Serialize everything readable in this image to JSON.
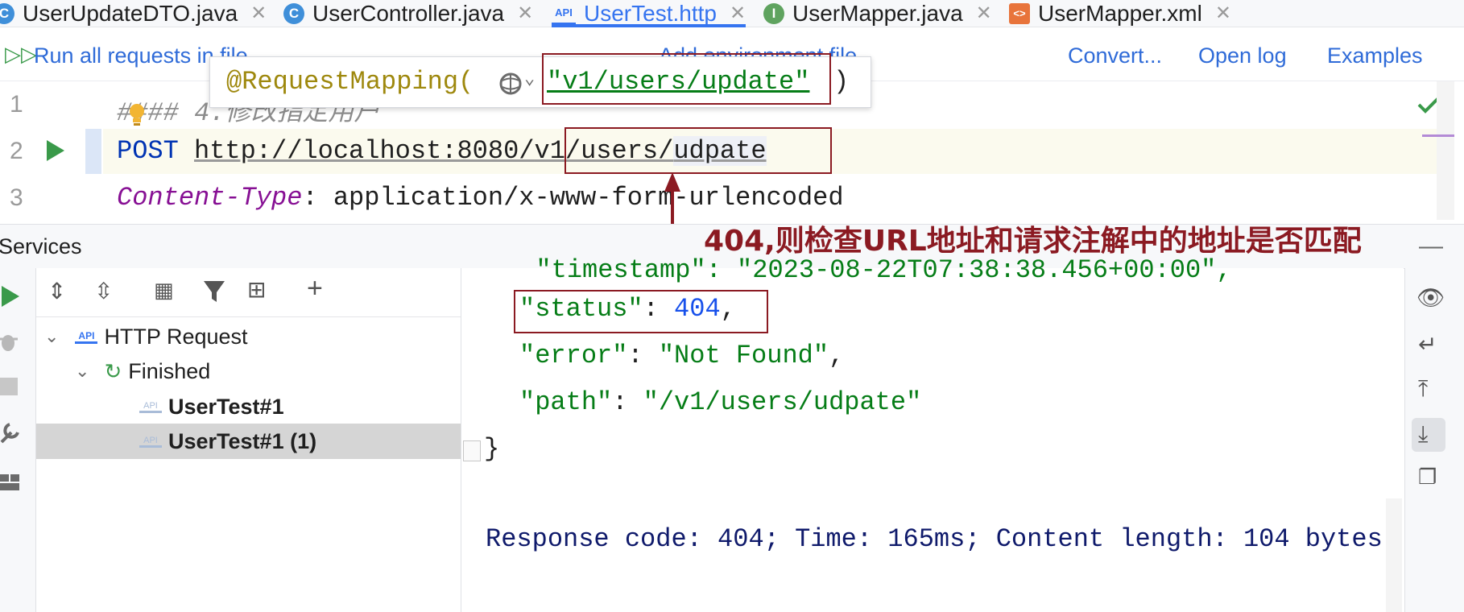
{
  "tabs": [
    {
      "label": "UserUpdateDTO.java",
      "icon": "class-icon"
    },
    {
      "label": "UserController.java",
      "icon": "class-icon"
    },
    {
      "label": "UserTest.http",
      "icon": "api-file-icon",
      "active": true
    },
    {
      "label": "UserMapper.java",
      "icon": "interface-icon"
    },
    {
      "label": "UserMapper.xml",
      "icon": "xml-file-icon"
    }
  ],
  "http_toolbar": {
    "run_all": "Run all requests in file",
    "add_env": "Add environment file",
    "convert": "Convert...",
    "open_log": "Open log",
    "examples": "Examples"
  },
  "editor": {
    "line_numbers": [
      "1",
      "2",
      "3"
    ],
    "line1": "#### 4.修改指定用户",
    "method": "POST",
    "url_prefix": "http://localhost:8080/",
    "url_path": "v1/users/",
    "url_tail": "udpate",
    "header_name": "Content-Type",
    "header_sep": ": ",
    "header_value": "application/x-www-form-urlencoded"
  },
  "tooltip": {
    "annotation": "@RequestMapping(",
    "value": "\"v1/users/update\"",
    "close": ")"
  },
  "annotation_note": "404,则检查URL地址和请求注解中的地址是否匹配",
  "services": {
    "title": "Services",
    "tree": {
      "root": "HTTP Request",
      "group": "Finished",
      "items": [
        "UserTest#1",
        "UserTest#1 (1)"
      ]
    }
  },
  "response": {
    "timestamp_line": "  \"timestamp\": \"2023-08-22T07:38:38.456+00:00\",",
    "status_key": "\"status\"",
    "status_value": "404",
    "error_key": "\"error\"",
    "error_value": "\"Not Found\"",
    "path_key": "\"path\"",
    "path_value": "\"/v1/users/udpate\"",
    "close_brace": "}",
    "summary": "Response code: 404; Time: 165ms; Content length: 104 bytes"
  },
  "colors": {
    "accent": "#3574f0",
    "annotation_red": "#8b1a22",
    "json_string": "#067d17",
    "json_number": "#1750eb",
    "keyword": "#0033b3",
    "header_name": "#871094"
  }
}
